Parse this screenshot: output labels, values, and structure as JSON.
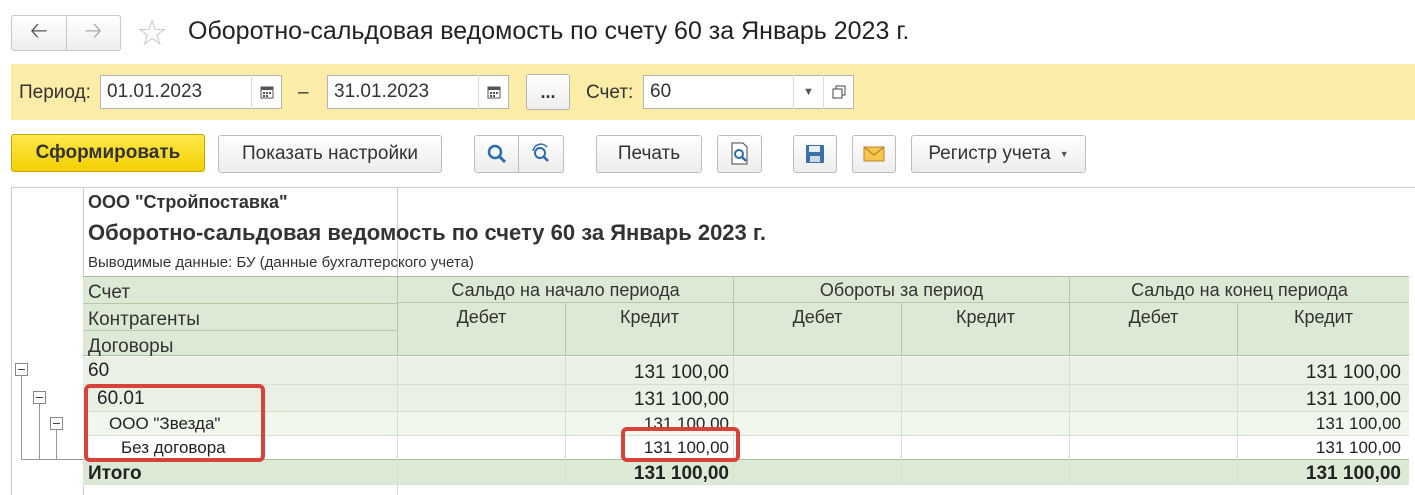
{
  "window": {
    "title": "Оборотно-сальдовая ведомость по счету 60 за Январь 2023 г.",
    "back_icon": "arrow-left",
    "forward_icon": "arrow-right",
    "favorite_icon": "star"
  },
  "params": {
    "period_label": "Период:",
    "date_from": "01.01.2023",
    "dash": "–",
    "date_to": "31.01.2023",
    "dots_label": "...",
    "account_label": "Счет:",
    "account_value": "60"
  },
  "toolbar": {
    "generate": "Сформировать",
    "show_settings": "Показать настройки",
    "print": "Печать",
    "register": "Регистр учета"
  },
  "report": {
    "org": "ООО \"Стройпоставка\"",
    "title": "Оборотно-сальдовая ведомость по счету 60 за Январь 2023 г.",
    "note": "Выводимые данные: БУ (данные бухгалтерского учета)",
    "header": {
      "col_account": "Счет",
      "col_contractors": "Контрагенты",
      "col_contracts": "Договоры",
      "opening": "Сальдо на начало периода",
      "turnover": "Обороты за период",
      "closing": "Сальдо на конец периода",
      "debit": "Дебет",
      "credit": "Кредит"
    },
    "rows": [
      {
        "name": "60",
        "open_credit": "131 100,00",
        "close_credit": "131 100,00"
      },
      {
        "name": "60.01",
        "open_credit": "131 100,00",
        "close_credit": "131 100,00"
      },
      {
        "name": "ООО \"Звезда\"",
        "open_credit": "131 100,00",
        "close_credit": "131 100,00"
      },
      {
        "name": "Без договора",
        "open_credit": "131 100,00",
        "close_credit": "131 100,00"
      }
    ],
    "total": {
      "name": "Итого",
      "open_credit": "131 100,00",
      "close_credit": "131 100,00"
    }
  },
  "colors": {
    "panel": "#fbeca8",
    "header_green": "#dce9d4",
    "primary_button": "#f3cf00",
    "highlight": "#d9413b"
  }
}
